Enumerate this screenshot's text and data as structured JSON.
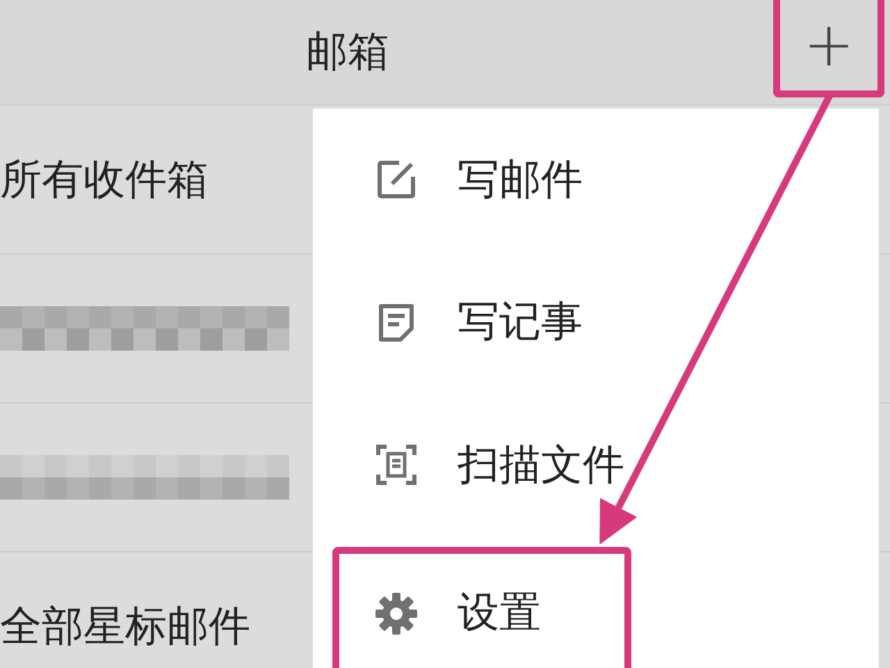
{
  "header": {
    "title": "邮箱",
    "add_button": {
      "label": "+",
      "highlighted": true
    }
  },
  "mailboxes": [
    {
      "kind": "text",
      "label": "所有收件箱"
    },
    {
      "kind": "redacted"
    },
    {
      "kind": "redacted"
    },
    {
      "kind": "text",
      "label": "全部星标邮件"
    }
  ],
  "menu": {
    "items": [
      {
        "kind": "compose",
        "label": "写邮件",
        "highlighted": false
      },
      {
        "kind": "note",
        "label": "写记事",
        "highlighted": false
      },
      {
        "kind": "scan",
        "label": "扫描文件",
        "highlighted": false
      },
      {
        "kind": "settings",
        "label": "设置",
        "highlighted": true
      }
    ]
  }
}
